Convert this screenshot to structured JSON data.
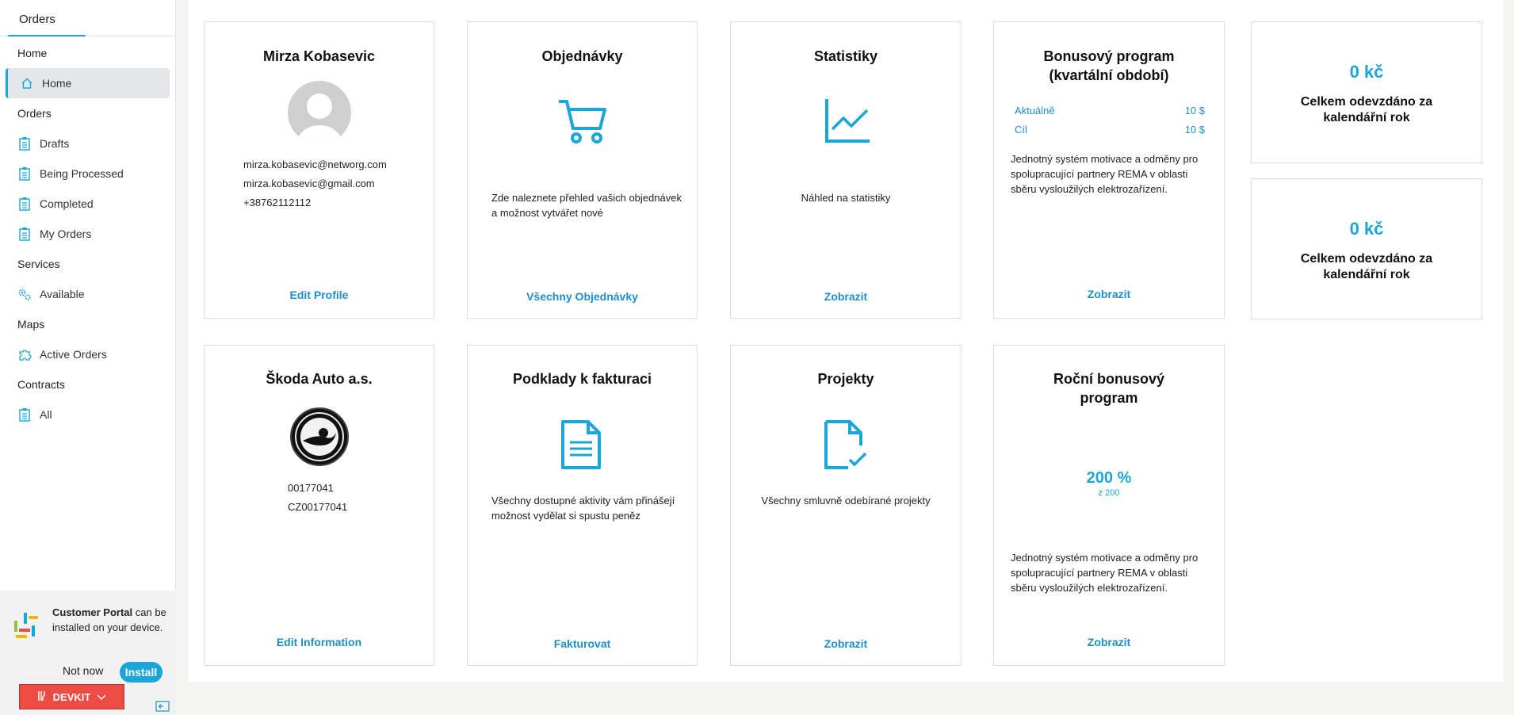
{
  "sidebar": {
    "tab_label": "Orders",
    "sections": [
      {
        "title": "Home",
        "items": [
          {
            "label": "Home",
            "icon": "home-icon",
            "active": true
          }
        ]
      },
      {
        "title": "Orders",
        "items": [
          {
            "label": "Drafts",
            "icon": "clipboard-icon"
          },
          {
            "label": "Being Processed",
            "icon": "clipboard-icon"
          },
          {
            "label": "Completed",
            "icon": "clipboard-icon"
          },
          {
            "label": "My Orders",
            "icon": "clipboard-icon"
          }
        ]
      },
      {
        "title": "Services",
        "items": [
          {
            "label": "Available",
            "icon": "gears-icon"
          }
        ]
      },
      {
        "title": "Maps",
        "items": [
          {
            "label": "Active Orders",
            "icon": "puzzle-icon"
          }
        ]
      },
      {
        "title": "Contracts",
        "items": [
          {
            "label": "All",
            "icon": "clipboard-icon"
          }
        ]
      }
    ],
    "install": {
      "app_name": "Customer Portal",
      "text_rest": " can be installed on your device.",
      "not_now": "Not now",
      "install": "Install"
    },
    "devkit_label": "DEVKIT"
  },
  "cards": {
    "profile": {
      "title": "Mirza Kobasevic",
      "email1": "mirza.kobasevic@networg.com",
      "email2": "mirza.kobasevic@gmail.com",
      "phone": "+38762112112",
      "link": "Edit Profile"
    },
    "orders": {
      "title": "Objednávky",
      "text": "Zde naleznete přehled vašich objednávek a možnost vytvářet nové",
      "link": "Všechny Objednávky"
    },
    "stats": {
      "title": "Statistiky",
      "text": "Náhled na statistiky",
      "link": "Zobrazit"
    },
    "bonus": {
      "title": "Bonusový program (kvartální období)",
      "rows": [
        {
          "label": "Aktuálně",
          "value": "10 $"
        },
        {
          "label": "Cíl",
          "value": "10 $"
        }
      ],
      "text": "Jednotný systém motivace a odměny pro spolupracující partnery REMA v oblasti sběru vysloužilých elektrozařízení.",
      "link": "Zobrazit"
    },
    "total1": {
      "value": "0 kč",
      "label": "Celkem odevzdáno za kalendářní rok"
    },
    "total2": {
      "value": "0 kč",
      "label": "Celkem odevzdáno za kalendářní rok"
    },
    "company": {
      "title": "Škoda Auto a.s.",
      "id1": "00177041",
      "id2": "CZ00177041",
      "link": "Edit Information"
    },
    "invoices": {
      "title": "Podklady k fakturaci",
      "text": "Všechny dostupné aktivity vám přinášejí možnost vydělat si spustu peněz",
      "link": "Fakturovat"
    },
    "projects": {
      "title": "Projekty",
      "text": "Všechny smluvně odebírané projekty",
      "link": "Zobrazit"
    },
    "annual": {
      "title": "Roční bonusový program",
      "percent": "200 %",
      "of": "z 200",
      "text": "Jednotný systém motivace a odměny pro spolupracující partnery REMA v oblasti sběru vysloužilých elektrozařízení.",
      "link": "Zobrazit"
    }
  },
  "colors": {
    "accent": "#1aa6d8",
    "link": "#1e8fc6",
    "devkit": "#ef4b45"
  }
}
